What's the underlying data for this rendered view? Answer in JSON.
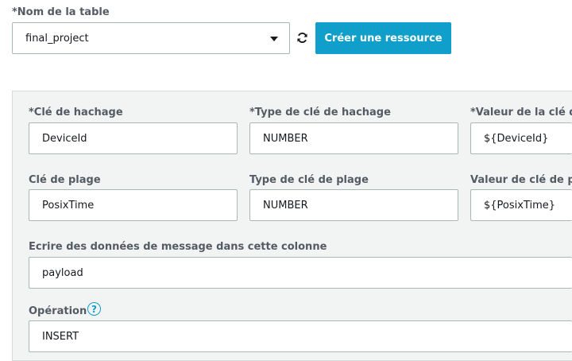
{
  "table_name": {
    "label": "*Nom de la table",
    "value": "final_project",
    "create_button": "Créer une ressource"
  },
  "hash_key": {
    "key_label": "*Clé de hachage",
    "key_value": "DeviceId",
    "type_label": "*Type de clé de hachage",
    "type_value": "NUMBER",
    "value_label": "*Valeur de la clé de",
    "value_value": "${DeviceId}"
  },
  "range_key": {
    "key_label": "Clé de plage",
    "key_value": "PosixTime",
    "type_label": "Type de clé de plage",
    "type_value": "NUMBER",
    "value_label": "Valeur de clé de pla",
    "value_value": "${PosixTime}"
  },
  "payload_column": {
    "label": "Ecrire des données de message dans cette colonne",
    "value": "payload"
  },
  "operation": {
    "label": "Opération",
    "help_glyph": "?",
    "value": "INSERT"
  },
  "colors": {
    "accent": "#0f9fca",
    "panel_bg": "#f2f3f3",
    "label_text": "#545b64"
  }
}
